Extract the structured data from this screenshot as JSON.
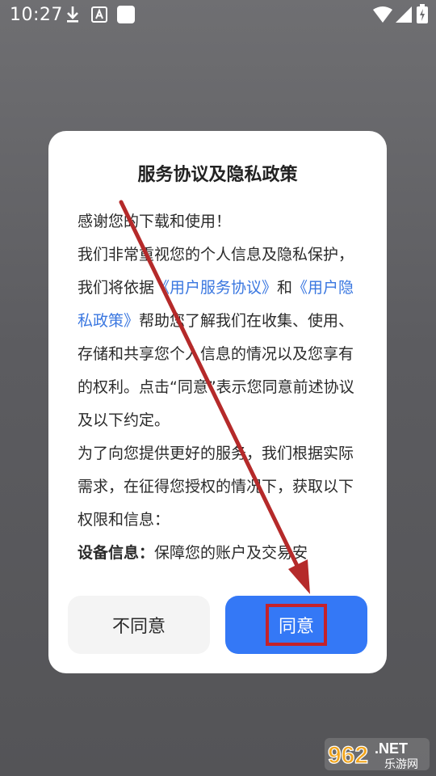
{
  "status_bar": {
    "time": "10:27",
    "icons": [
      "download-icon",
      "a-icon",
      "square-icon",
      "wifi-icon",
      "signal-icon",
      "battery-icon"
    ]
  },
  "dialog": {
    "title": "服务协议及隐私政策",
    "body": {
      "greeting": "感谢您的下载和使用！",
      "p1": "我们非常重视您的个人信息及隐私保护，我们将依据",
      "link1": "《用户服务协议》",
      "and": "和",
      "link2": "《用户隐私政策》",
      "p1_end": "帮助您了解我们在收集、使用、存储和共享您个人信息的情况以及您享有的权利。点击“同意”表示您同意前述协议及以下约定。",
      "p2": "为了向您提供更好的服务，我们根据实际需求，在征得您授权的情况下，获取以下权限和信息：",
      "p3_bold": "设备信息：",
      "p3": "保障您的账户及交易安"
    },
    "buttons": {
      "disagree": "不同意",
      "agree": "同意"
    }
  },
  "colors": {
    "link": "#3a77e0",
    "primary_button": "#3478f6",
    "annotation": "#c4222a"
  },
  "watermark": {
    "number": "962",
    "suffix": ".NET",
    "site": "乐游网"
  }
}
